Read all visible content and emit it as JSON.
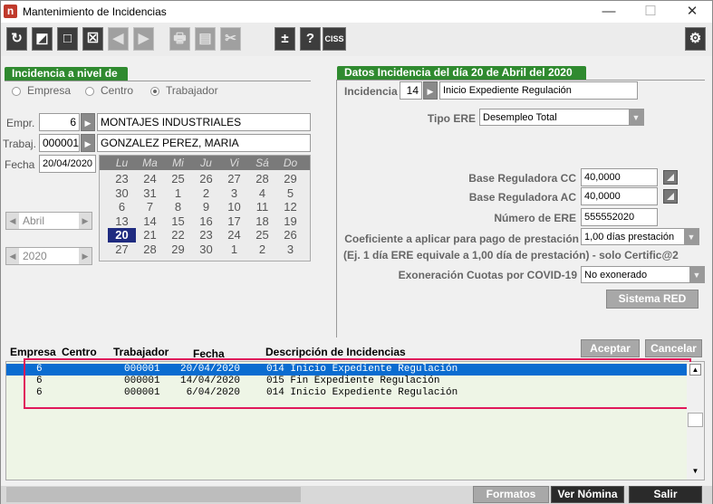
{
  "window": {
    "title": "Mantenimiento de Incidencias",
    "minimize": "—",
    "maximize": "☐",
    "close": "✕"
  },
  "toolbar": {
    "buttons": [
      "↻",
      "◩",
      "□",
      "☒",
      "◀",
      "▶",
      "🖶",
      "▤",
      "✂",
      "±",
      "?",
      "CISS"
    ],
    "settings": "⚙"
  },
  "left": {
    "section_title": "Incidencia a nivel de",
    "radios": [
      {
        "label": "Empresa",
        "checked": false
      },
      {
        "label": "Centro",
        "checked": false
      },
      {
        "label": "Trabajador",
        "checked": true
      }
    ],
    "empr_label": "Empr.",
    "empr_code": "6",
    "empr_name": "MONTAJES INDUSTRIALES",
    "trab_label": "Trabaj.",
    "trab_code": "000001",
    "trab_name": "GONZALEZ PEREZ, MARIA",
    "fecha_label": "Fecha",
    "fecha_value": "20/04/2020",
    "month": "Abril",
    "year": "2020"
  },
  "calendar": {
    "days": [
      "Lu",
      "Ma",
      "Mi",
      "Ju",
      "Vi",
      "Sá",
      "Do"
    ],
    "weeks": [
      [
        "23",
        "24",
        "25",
        "26",
        "27",
        "28",
        "29"
      ],
      [
        "30",
        "31",
        "1",
        "2",
        "3",
        "4",
        "5"
      ],
      [
        "6",
        "7",
        "8",
        "9",
        "10",
        "11",
        "12"
      ],
      [
        "13",
        "14",
        "15",
        "16",
        "17",
        "18",
        "19"
      ],
      [
        "20",
        "21",
        "22",
        "23",
        "24",
        "25",
        "26"
      ],
      [
        "27",
        "28",
        "29",
        "30",
        "1",
        "2",
        "3"
      ]
    ],
    "selected": "20"
  },
  "right": {
    "section_title": "Datos Incidencia del día 20 de Abril del 2020",
    "incidencia_label": "Incidencia",
    "incidencia_code": "14",
    "incidencia_desc": "Inicio Expediente Regulación",
    "tipo_ere_label": "Tipo ERE",
    "tipo_ere_value": "Desempleo Total",
    "base_cc_label": "Base Reguladora CC",
    "base_cc_value": "40,0000",
    "base_ac_label": "Base Reguladora AC",
    "base_ac_value": "40,0000",
    "num_ere_label": "Número de ERE",
    "num_ere_value": "555552020",
    "coef_label": "Coeficiente a aplicar para pago de prestación",
    "coef_value": "1,00 días prestación",
    "coef_note": "(Ej. 1 día ERE equivale a 1,00 día de prestación) - solo Certific@2",
    "exo_label": "Exoneración Cuotas por COVID-19",
    "exo_value": "No exonerado",
    "sistema_red": "Sistema RED",
    "aceptar": "Aceptar",
    "cancelar": "Cancelar"
  },
  "list": {
    "headers": [
      "Empresa",
      "Centro",
      "Trabajador",
      "Fecha",
      "Descripción de Incidencias"
    ],
    "rows": [
      {
        "empresa": "6",
        "trabajador": "000001",
        "fecha": "20/04/2020",
        "desc": "014 Inicio Expediente Regulación"
      },
      {
        "empresa": "6",
        "trabajador": "000001",
        "fecha": "14/04/2020",
        "desc": "015 Fin Expediente Regulación"
      },
      {
        "empresa": "6",
        "trabajador": "000001",
        "fecha": "6/04/2020",
        "desc": "014 Inicio Expediente Regulación"
      }
    ]
  },
  "footer": {
    "formatos": "Formatos",
    "ver_nomina": "Ver Nómina",
    "salir": "Salir"
  }
}
